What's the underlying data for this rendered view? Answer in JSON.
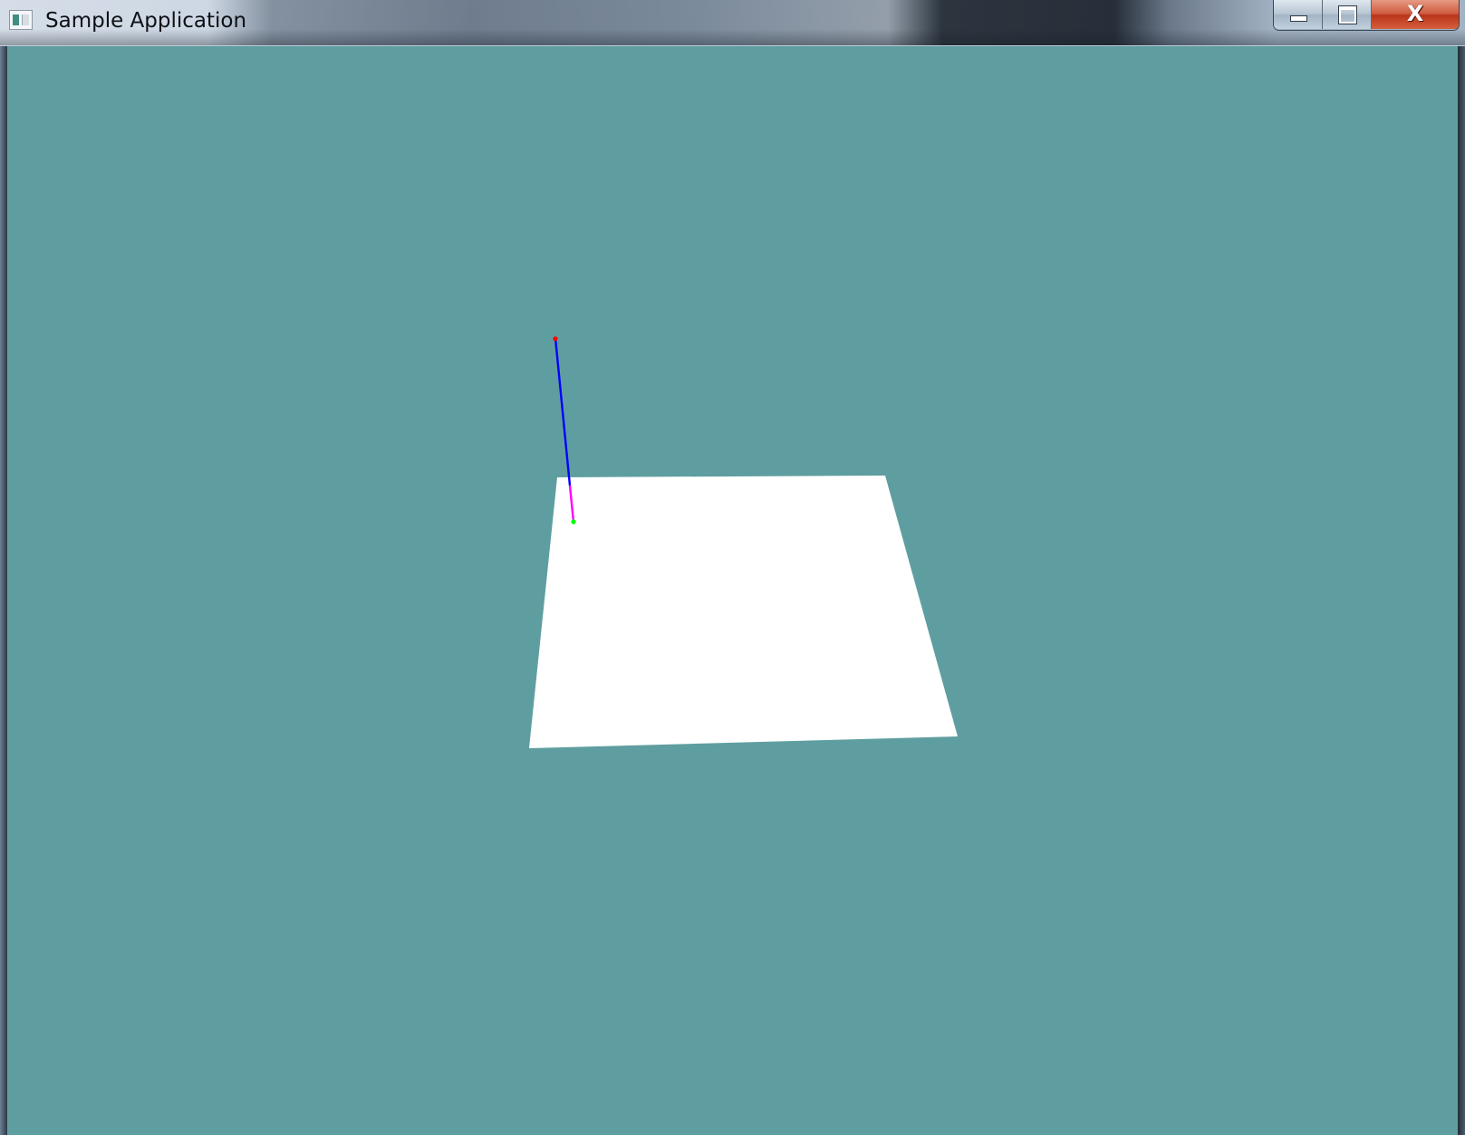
{
  "window": {
    "title": "Sample Application",
    "icon": "application-icon",
    "controls": {
      "minimize": "minimize-icon",
      "maximize": "maximize-icon",
      "close_glyph": "X"
    }
  },
  "viewport": {
    "background_color": "#5f9ea0",
    "plane_color": "#ffffff",
    "axis_colors": {
      "main_line": "#0000ff",
      "lower_segment": "#ff00ff",
      "top_endpoint": "#ff0000",
      "bottom_endpoint": "#00ff00"
    }
  }
}
